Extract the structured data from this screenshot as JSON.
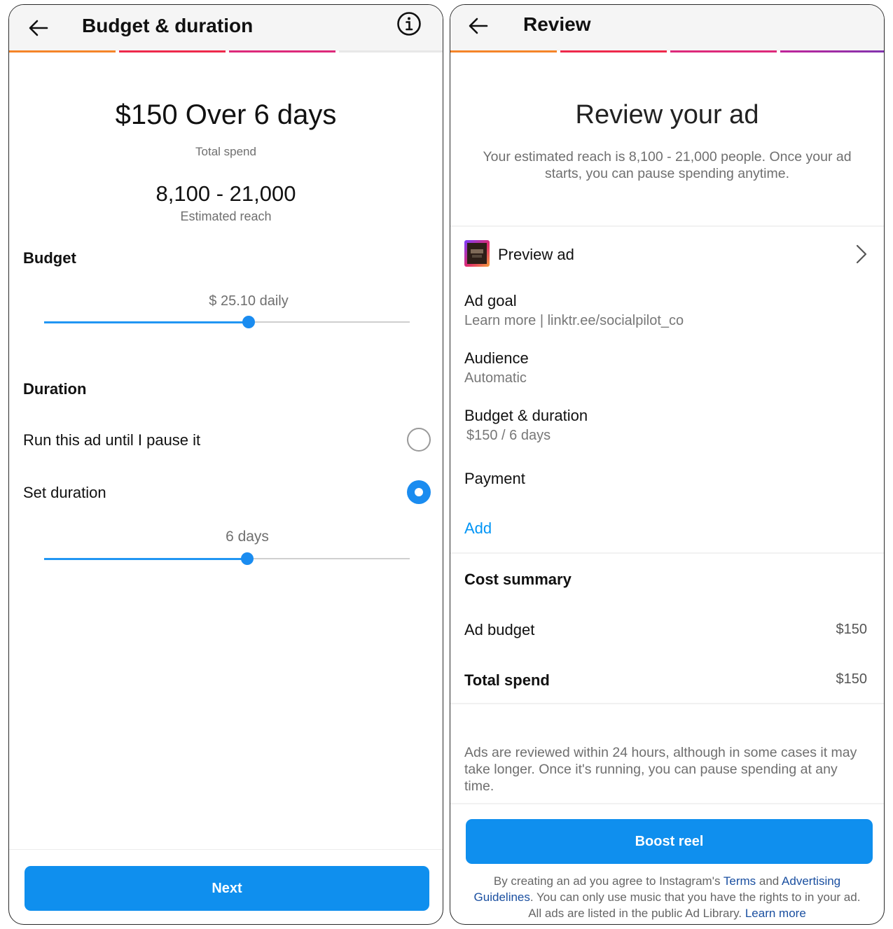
{
  "left": {
    "header": {
      "title": "Budget & duration"
    },
    "summary": {
      "headline": "$150 Over 6 days",
      "headline_caption": "Total spend",
      "reach": "8,100 - 21,000",
      "reach_caption": "Estimated reach"
    },
    "budget": {
      "heading": "Budget",
      "value_label": "$ 25.10 daily",
      "slider_fraction": 0.56
    },
    "duration": {
      "heading": "Duration",
      "options": [
        {
          "label": "Run this ad until I pause it",
          "selected": false
        },
        {
          "label": "Set duration",
          "selected": true
        }
      ],
      "value_label": "6 days",
      "slider_fraction": 0.556
    },
    "footer": {
      "next_label": "Next"
    }
  },
  "right": {
    "header": {
      "title": "Review"
    },
    "intro": {
      "heading": "Review your ad",
      "text_line1": "Your estimated reach is 8,100 - 21,000 people. Once your ad",
      "text_line2": "starts, you can pause spending anytime."
    },
    "preview": {
      "label": "Preview ad"
    },
    "details": [
      {
        "label": "Ad goal",
        "value": "Learn more | linktr.ee/socialpilot_co"
      },
      {
        "label": "Audience",
        "value": "Automatic"
      },
      {
        "label": "Budget & duration",
        "value": "$150 / 6 days"
      }
    ],
    "payment": {
      "label": "Payment",
      "action": "Add"
    },
    "cost_summary": {
      "heading": "Cost summary",
      "rows": [
        {
          "label": "Ad budget",
          "amount": "$150"
        },
        {
          "label": "Total spend",
          "amount": "$150"
        }
      ]
    },
    "notice": {
      "line1": "Ads are reviewed within 24 hours, although in some cases it may",
      "line2": "take longer. Once it's running, you can pause spending at any",
      "line3": "time."
    },
    "boost_label": "Boost reel",
    "legal": {
      "l1_a": "By creating an ad you agree to Instagram's ",
      "terms": "Terms",
      "l1_b": " and ",
      "advertising": "Advertising",
      "guidelines": "Guidelines",
      "l2_b": ". You can only use music that you have the rights to in your ad.",
      "l3_a": "All ads are listed in the public Ad Library. ",
      "learn_more": "Learn more"
    }
  },
  "colors": {
    "accent_blue": "#0f8fee",
    "progress": [
      "#f58529",
      "#ee2a4b",
      "#dd2a7b",
      "#c0249a",
      "#8134af"
    ]
  }
}
